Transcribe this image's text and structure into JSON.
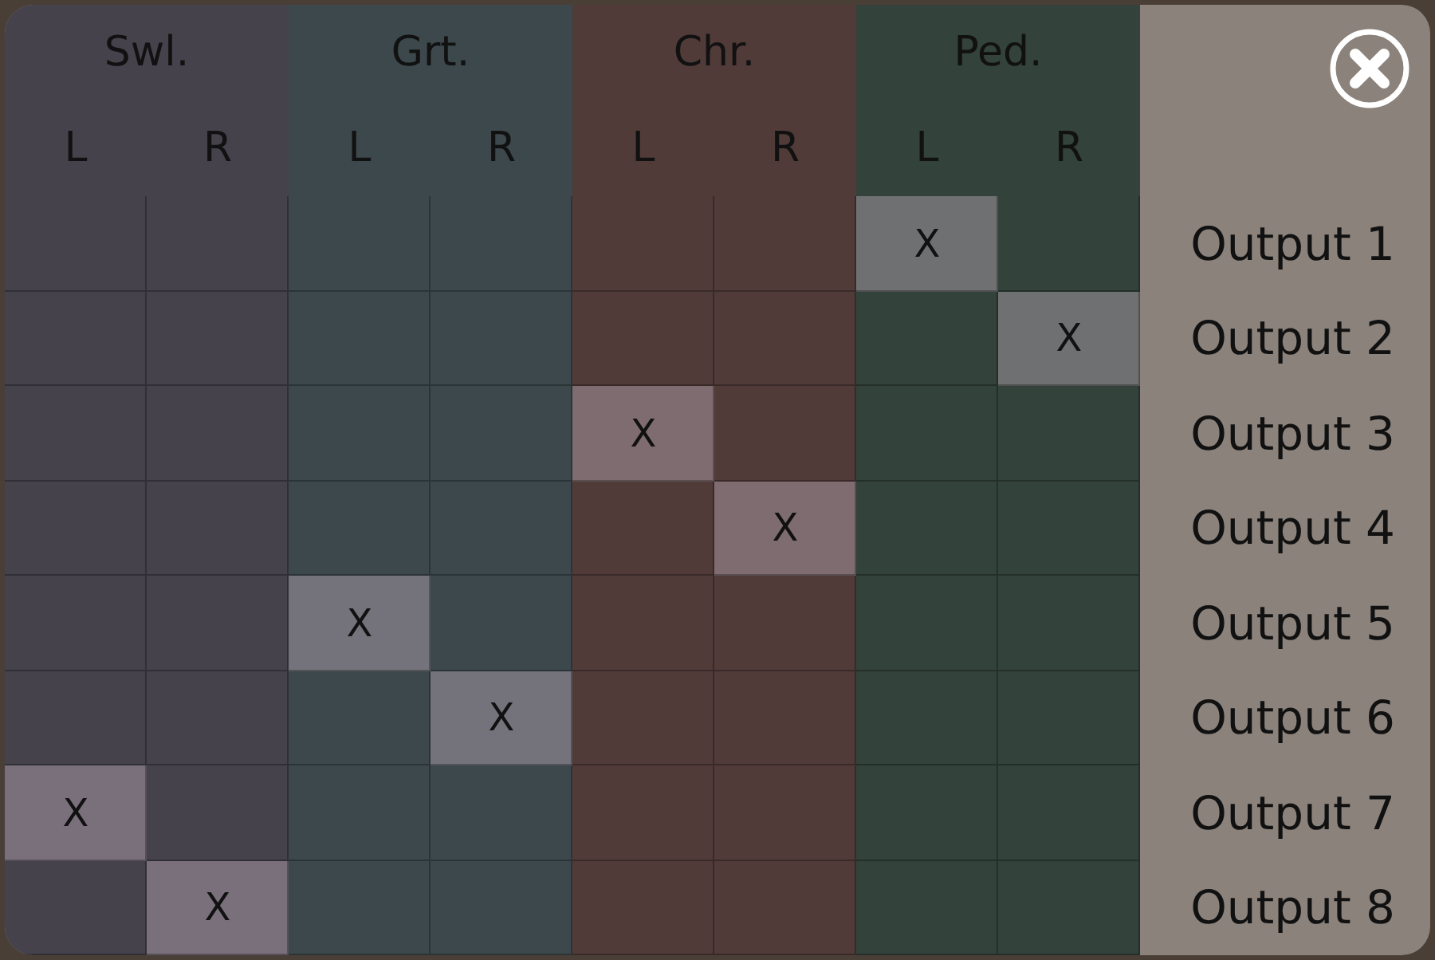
{
  "groups": [
    {
      "name": "Swl.",
      "color": "#45424c",
      "channels": [
        "L",
        "R"
      ]
    },
    {
      "name": "Grt.",
      "color": "#3c484c",
      "channels": [
        "L",
        "R"
      ]
    },
    {
      "name": "Chr.",
      "color": "#503b39",
      "channels": [
        "L",
        "R"
      ]
    },
    {
      "name": "Ped.",
      "color": "#33423a",
      "channels": [
        "L",
        "R"
      ]
    }
  ],
  "outputs": [
    {
      "label": "Output 1",
      "cells": [
        {
          "selected": false
        },
        {
          "selected": false
        },
        {
          "selected": false
        },
        {
          "selected": false
        },
        {
          "selected": false
        },
        {
          "selected": false
        },
        {
          "selected": true,
          "mark": "X"
        },
        {
          "selected": false
        }
      ]
    },
    {
      "label": "Output 2",
      "cells": [
        {
          "selected": false
        },
        {
          "selected": false
        },
        {
          "selected": false
        },
        {
          "selected": false
        },
        {
          "selected": false
        },
        {
          "selected": false
        },
        {
          "selected": false
        },
        {
          "selected": true,
          "mark": "X"
        }
      ]
    },
    {
      "label": "Output 3",
      "cells": [
        {
          "selected": false
        },
        {
          "selected": false
        },
        {
          "selected": false
        },
        {
          "selected": false
        },
        {
          "selected": true,
          "mark": "X"
        },
        {
          "selected": false
        },
        {
          "selected": false
        },
        {
          "selected": false
        }
      ]
    },
    {
      "label": "Output 4",
      "cells": [
        {
          "selected": false
        },
        {
          "selected": false
        },
        {
          "selected": false
        },
        {
          "selected": false
        },
        {
          "selected": false
        },
        {
          "selected": true,
          "mark": "X"
        },
        {
          "selected": false
        },
        {
          "selected": false
        }
      ]
    },
    {
      "label": "Output 5",
      "cells": [
        {
          "selected": false
        },
        {
          "selected": false
        },
        {
          "selected": true,
          "mark": "X"
        },
        {
          "selected": false
        },
        {
          "selected": false
        },
        {
          "selected": false
        },
        {
          "selected": false
        },
        {
          "selected": false
        }
      ]
    },
    {
      "label": "Output 6",
      "cells": [
        {
          "selected": false
        },
        {
          "selected": false
        },
        {
          "selected": false
        },
        {
          "selected": true,
          "mark": "X"
        },
        {
          "selected": false
        },
        {
          "selected": false
        },
        {
          "selected": false
        },
        {
          "selected": false
        }
      ]
    },
    {
      "label": "Output 7",
      "cells": [
        {
          "selected": true,
          "mark": "X"
        },
        {
          "selected": false
        },
        {
          "selected": false
        },
        {
          "selected": false
        },
        {
          "selected": false
        },
        {
          "selected": false
        },
        {
          "selected": false
        },
        {
          "selected": false
        }
      ]
    },
    {
      "label": "Output 8",
      "cells": [
        {
          "selected": false
        },
        {
          "selected": true,
          "mark": "X"
        },
        {
          "selected": false
        },
        {
          "selected": false
        },
        {
          "selected": false
        },
        {
          "selected": false
        },
        {
          "selected": false
        },
        {
          "selected": false
        }
      ]
    }
  ]
}
